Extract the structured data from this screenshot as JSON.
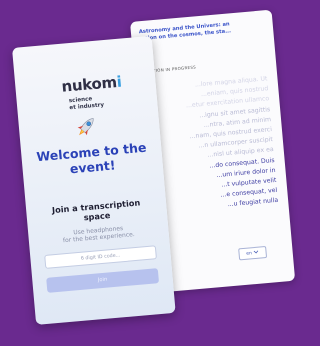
{
  "colors": {
    "background": "#6a2a8f",
    "accent": "#2b42b7",
    "link_title": "#3b54c9",
    "button_disabled": "#b7c2ee"
  },
  "transcription_screen": {
    "title_lines": [
      "Astronomy and the Univers: an",
      "...tion on the cosmos, the sta..."
    ],
    "status": "...TION IN PROGRESS",
    "transcript_lines": [
      {
        "text": "...lore magna aliqua. Ut",
        "tone": "faint"
      },
      {
        "text": "...eniam, quis nostrud",
        "tone": "faint"
      },
      {
        "text": "...etur exercitation ullamco",
        "tone": "faint"
      },
      {
        "text": "...ignu sit amet sagittis",
        "tone": "mid"
      },
      {
        "text": "...ntra, atim ad minim",
        "tone": "mid"
      },
      {
        "text": "...nam, quis nostrud exerci",
        "tone": "mid"
      },
      {
        "text": "...n ullamcorper suscipit",
        "tone": "mid"
      },
      {
        "text": "...nisl ut aliquip ex ea",
        "tone": "mid"
      },
      {
        "text": "...do consequat. Duis",
        "tone": "strong"
      },
      {
        "text": "...um iriure dolor in",
        "tone": "strong"
      },
      {
        "text": "...t vulputate velit",
        "tone": "strong"
      },
      {
        "text": "...e consequat, vel",
        "tone": "strong"
      },
      {
        "text": "...u feugiat nulla",
        "tone": "strong"
      }
    ],
    "language_button": "en",
    "chevron_icon": "chevron-down-icon"
  },
  "join_screen": {
    "logo_text": "nukom",
    "logo_suffix": "i",
    "tagline_line1": "science",
    "tagline_line2": "et industry",
    "rocket_icon": "rocket-icon",
    "welcome_line1": "Welcome to the",
    "welcome_line2": "event!",
    "join_title_line1": "Join a transcription",
    "join_title_line2": "space",
    "hint_line1": "Use headphones",
    "hint_line2": "for the best experience.",
    "code_placeholder": "6 digit ID code...",
    "join_button_label": "Join"
  }
}
